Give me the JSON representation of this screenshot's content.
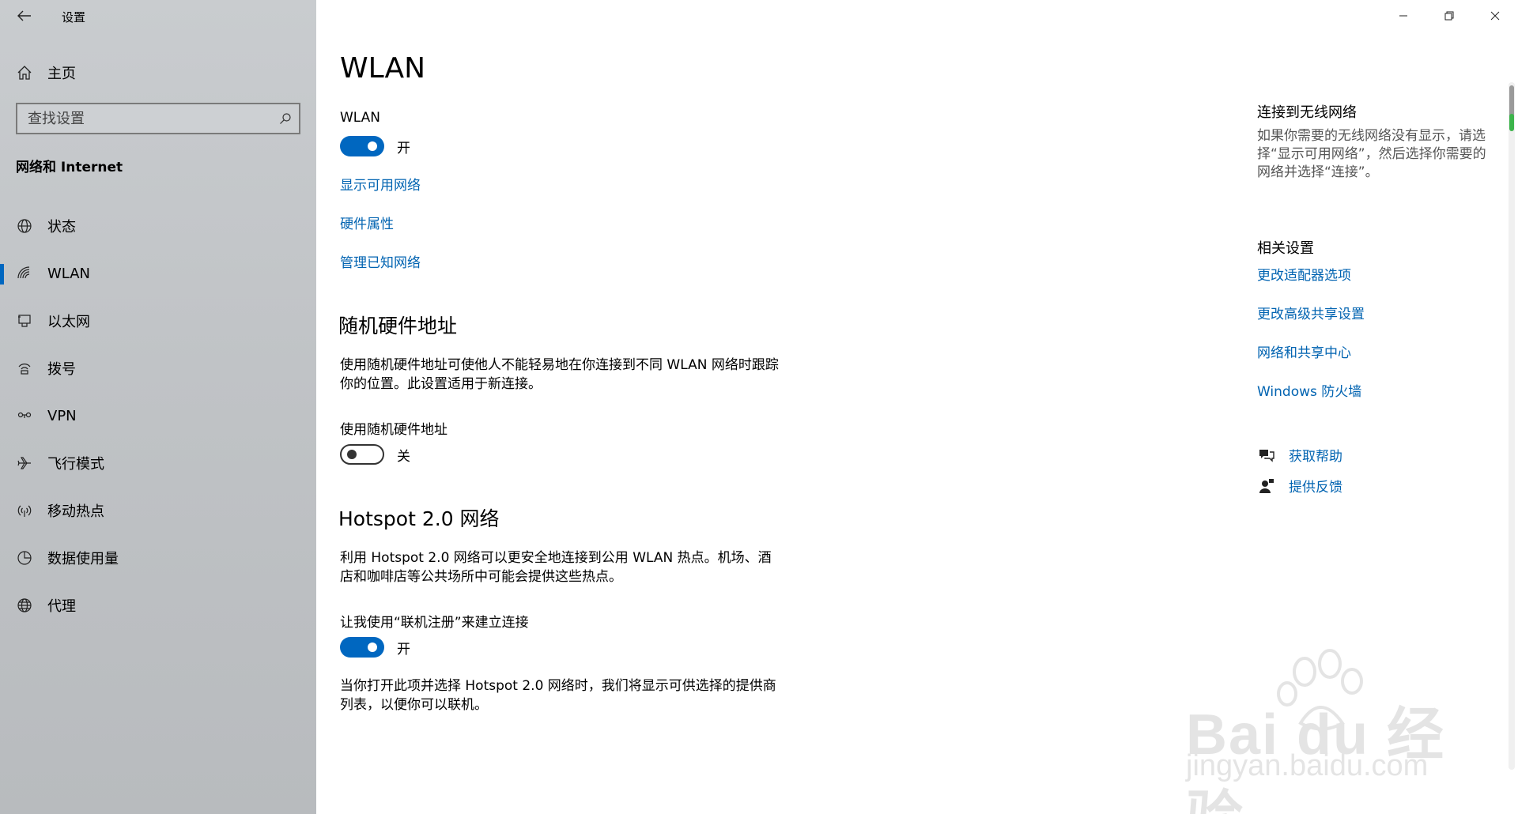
{
  "window": {
    "title": "设置"
  },
  "sidebar": {
    "home_label": "主页",
    "search_placeholder": "查找设置",
    "section_title": "网络和 Internet",
    "items": [
      {
        "label": "状态",
        "icon": "globe-status-icon",
        "active": false
      },
      {
        "label": "WLAN",
        "icon": "wifi-icon",
        "active": true
      },
      {
        "label": "以太网",
        "icon": "ethernet-icon",
        "active": false
      },
      {
        "label": "拨号",
        "icon": "dialup-icon",
        "active": false
      },
      {
        "label": "VPN",
        "icon": "vpn-icon",
        "active": false
      },
      {
        "label": "飞行模式",
        "icon": "airplane-icon",
        "active": false
      },
      {
        "label": "移动热点",
        "icon": "hotspot-icon",
        "active": false
      },
      {
        "label": "数据使用量",
        "icon": "data-usage-icon",
        "active": false
      },
      {
        "label": "代理",
        "icon": "proxy-globe-icon",
        "active": false
      }
    ]
  },
  "main": {
    "title": "WLAN",
    "wlan_label": "WLAN",
    "wlan_toggle_state": "开",
    "links": [
      "显示可用网络",
      "硬件属性",
      "管理已知网络"
    ],
    "random_hw": {
      "title": "随机硬件地址",
      "description": "使用随机硬件地址可使他人不能轻易地在你连接到不同 WLAN 网络时跟踪你的位置。此设置适用于新连接。",
      "toggle_label": "使用随机硬件地址",
      "toggle_state": "关"
    },
    "hotspot": {
      "title": "Hotspot 2.0 网络",
      "description": "利用 Hotspot 2.0 网络可以更安全地连接到公用 WLAN 热点。机场、酒店和咖啡店等公共场所中可能会提供这些热点。",
      "toggle_label": "让我使用“联机注册”来建立连接",
      "toggle_state": "开",
      "note": "当你打开此项并选择 Hotspot 2.0 网络时，我们将显示可供选择的提供商列表，以便你可以联机。"
    }
  },
  "aside": {
    "connect_title": "连接到无线网络",
    "connect_text": "如果你需要的无线网络没有显示，请选择“显示可用网络”，然后选择你需要的网络并选择“连接”。",
    "related_title": "相关设置",
    "related_links": [
      "更改适配器选项",
      "更改高级共享设置",
      "网络和共享中心",
      "Windows 防火墙"
    ],
    "help_label": "获取帮助",
    "feedback_label": "提供反馈"
  },
  "watermark": {
    "brand": "Bai du 经验",
    "url": "jingyan.baidu.com"
  },
  "colors": {
    "accent": "#0067c0",
    "link": "#0063b1",
    "sidebar_bg": "#c0c3c6"
  }
}
